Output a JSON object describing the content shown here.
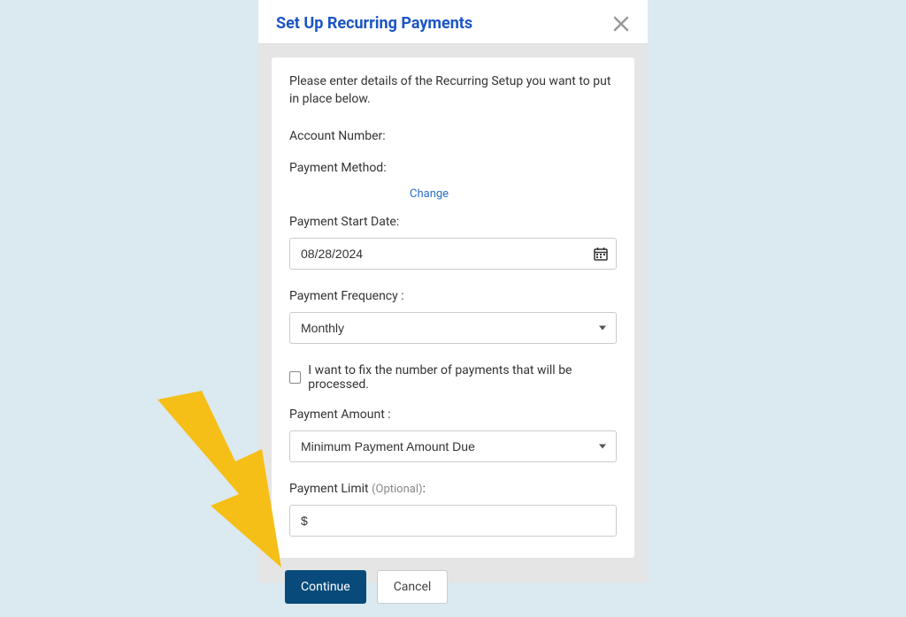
{
  "modal": {
    "title": "Set Up Recurring Payments"
  },
  "card": {
    "intro": "Please enter details of the Recurring Setup you want to put in place below.",
    "accountNumber": {
      "label": "Account Number:",
      "value": ""
    },
    "paymentMethod": {
      "label": "Payment Method:",
      "value": ""
    },
    "changeLink": "Change",
    "startDate": {
      "label": "Payment Start Date:",
      "value": "08/28/2024"
    },
    "frequency": {
      "label": "Payment Frequency :",
      "value": "Monthly"
    },
    "fixCheckbox": {
      "label": "I want to fix the number of payments that will be processed."
    },
    "amount": {
      "label": "Payment Amount :",
      "value": "Minimum Payment Amount Due"
    },
    "limit": {
      "label": "Payment Limit ",
      "optionalHint": "(Optional)",
      "colon": ":",
      "value": "$"
    }
  },
  "buttons": {
    "continue": "Continue",
    "cancel": "Cancel"
  },
  "colors": {
    "titleBlue": "#1b55c4",
    "linkBlue": "#2a6fc9",
    "primaryBtn": "#084b7a",
    "pageBg": "#dbe9f0",
    "arrow": "#f6bf17"
  }
}
